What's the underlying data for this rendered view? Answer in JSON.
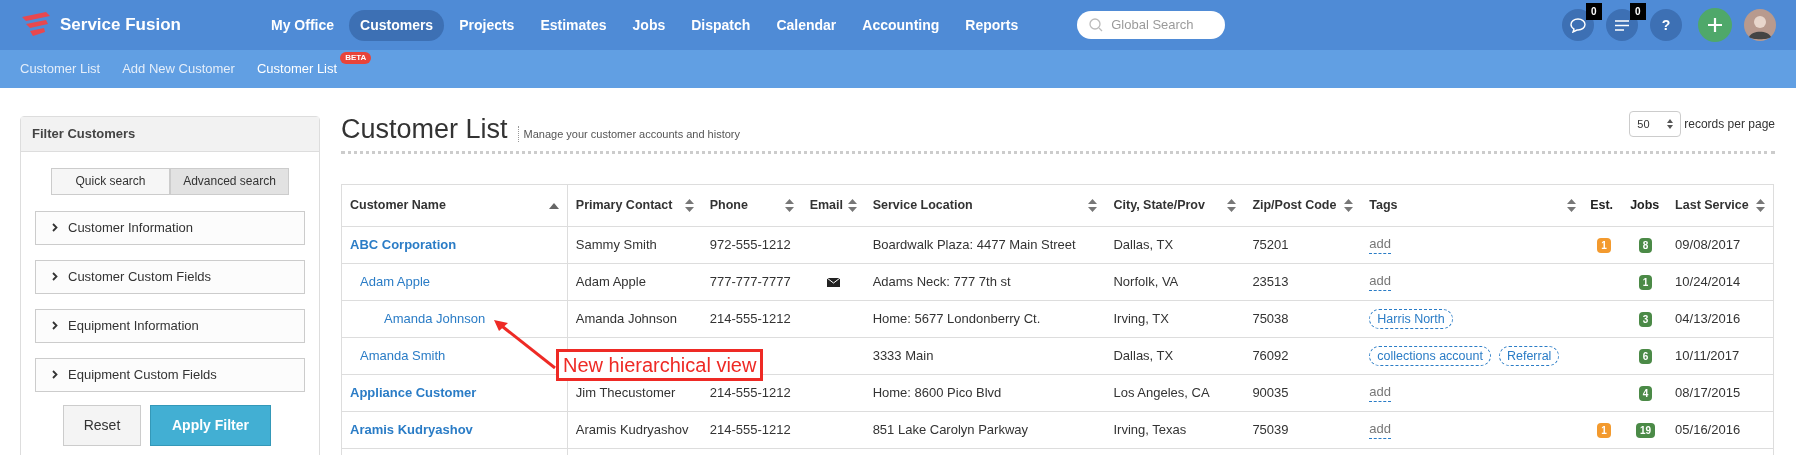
{
  "brand": {
    "name": "Service Fusion"
  },
  "nav": [
    {
      "label": "My Office",
      "selected": false
    },
    {
      "label": "Customers",
      "selected": true
    },
    {
      "label": "Projects",
      "selected": false
    },
    {
      "label": "Estimates",
      "selected": false
    },
    {
      "label": "Jobs",
      "selected": false
    },
    {
      "label": "Dispatch",
      "selected": false
    },
    {
      "label": "Calendar",
      "selected": false
    },
    {
      "label": "Accounting",
      "selected": false
    },
    {
      "label": "Reports",
      "selected": false
    }
  ],
  "search": {
    "placeholder": "Global Search"
  },
  "header_icons": {
    "messages_count": "0",
    "tasks_count": "0",
    "help": "?"
  },
  "subnav": [
    {
      "label": "Customer List",
      "selected": false
    },
    {
      "label": "Add New Customer",
      "selected": false
    },
    {
      "label": "Customer List",
      "badge": "BETA",
      "selected": true
    }
  ],
  "filter": {
    "title": "Filter Customers",
    "modes": [
      {
        "label": "Quick search",
        "selected": false
      },
      {
        "label": "Advanced search",
        "selected": true
      }
    ],
    "sections": [
      "Customer Information",
      "Customer Custom Fields",
      "Equipment Information",
      "Equipment Custom Fields"
    ],
    "buttons": {
      "reset": "Reset",
      "apply": "Apply Filter"
    }
  },
  "page": {
    "title": "Customer List",
    "subtitle": "Manage your customer accounts and history",
    "page_size": "50",
    "page_size_label": "records per page"
  },
  "table": {
    "columns": [
      {
        "label": "Customer Name",
        "sortable": true,
        "sorted": true
      },
      {
        "label": "Primary Contact",
        "sortable": true,
        "sorted": false
      },
      {
        "label": "Phone",
        "sortable": true,
        "sorted": false
      },
      {
        "label": "Email",
        "sortable": true,
        "sorted": false
      },
      {
        "label": "Service Location",
        "sortable": true,
        "sorted": false
      },
      {
        "label": "City, State/Prov",
        "sortable": true,
        "sorted": false
      },
      {
        "label": "Zip/Post Code",
        "sortable": true,
        "sorted": false
      },
      {
        "label": "Tags",
        "sortable": true,
        "sorted": false
      },
      {
        "label": "Est.",
        "sortable": false,
        "sorted": false
      },
      {
        "label": "Jobs",
        "sortable": false,
        "sorted": false
      },
      {
        "label": "Last Service",
        "sortable": true,
        "sorted": false
      }
    ],
    "rows": [
      {
        "name": "ABC Corporation",
        "contact": "Sammy Smith",
        "phone": "972-555-1212",
        "email": false,
        "location": "Boardwalk Plaza: 4477 Main Street",
        "city": "Dallas, TX",
        "zip": "75201",
        "add": "add",
        "est": "1",
        "jobs": "8",
        "last": "09/08/2017",
        "children": [
          {
            "name": "Adam Apple",
            "contact": "Adam Apple",
            "phone": "777-777-7777",
            "email": true,
            "location": "Adams Neck: 777 7th st",
            "city": "Norfolk, VA",
            "zip": "23513",
            "add": "add",
            "jobs": "1",
            "last": "10/24/2014",
            "children": [
              {
                "name": "Amanda Johnson",
                "contact": "Amanda Johnson",
                "phone": "214-555-1212",
                "email": false,
                "location": "Home: 5677 Londonberry Ct.",
                "city": "Irving, TX",
                "zip": "75038",
                "tags": [
                  "Harris North"
                ],
                "jobs": "3",
                "last": "04/13/2016"
              }
            ]
          },
          {
            "name": "Amanda Smith",
            "email": false,
            "location": "3333 Main",
            "city": "Dallas, TX",
            "zip": "76092",
            "tags": [
              "collections account",
              "Referral"
            ],
            "jobs": "6",
            "last": "10/11/2017"
          }
        ]
      },
      {
        "name": "Appliance Customer",
        "contact": "Jim Thecustomer",
        "phone": "214-555-1212",
        "email": false,
        "location": "Home: 8600 Pico Blvd",
        "city": "Los Angeles, CA",
        "zip": "90035",
        "add": "add",
        "jobs": "4",
        "last": "08/17/2015"
      },
      {
        "name": "Aramis Kudryashov",
        "contact": "Aramis Kudryashov",
        "phone": "214-555-1212",
        "email": false,
        "location": "851 Lake Carolyn Parkway",
        "city": "Irving, Texas",
        "zip": "75039",
        "add": "add",
        "est": "1",
        "jobs": "19",
        "last": "05/16/2016"
      }
    ]
  },
  "annotation": {
    "text": "New hierarchical view"
  }
}
